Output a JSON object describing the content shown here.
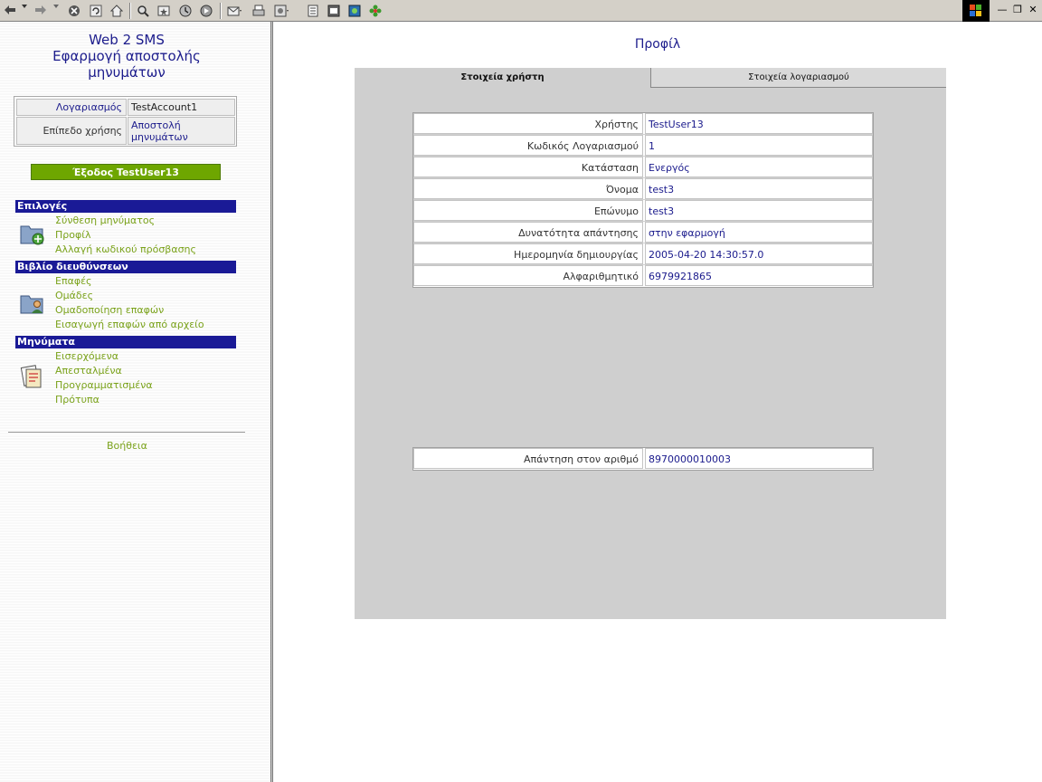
{
  "browser": {
    "toolbar_buttons": [
      "back-icon",
      "forward-icon",
      "stop-icon",
      "refresh-icon",
      "home-icon",
      "search-icon",
      "favorites-icon",
      "history-icon",
      "media-icon",
      "mail-icon",
      "print-icon",
      "edit-icon",
      "notes-icon",
      "sms-icon",
      "messenger-icon",
      "icq-icon"
    ]
  },
  "sidebar": {
    "app_title_line1": "Web 2 SMS",
    "app_title_line2": "Εφαρμογή αποστολής",
    "app_title_line3": "μηνυμάτων",
    "account_label": "Λογαριασμός",
    "account_value": "TestAccount1",
    "level_label": "Επίπεδο χρήσης",
    "level_value_line1": "Αποστολή",
    "level_value_line2": "μηνυμάτων",
    "logout_label": "Έξοδος TestUser13",
    "sections": [
      {
        "title": "Επιλογές",
        "items": [
          "Σύνθεση μηνύματος",
          "Προφίλ",
          "Αλλαγή κωδικού πρόσβασης"
        ]
      },
      {
        "title": "Βιβλίο διευθύνσεων",
        "items": [
          "Επαφές",
          "Ομάδες",
          "Ομαδοποίηση επαφών",
          "Εισαγωγή επαφών από αρχείο"
        ]
      },
      {
        "title": "Μηνύματα",
        "items": [
          "Εισερχόμενα",
          "Απεσταλμένα",
          "Προγραμματισμένα",
          "Πρότυπα"
        ]
      }
    ],
    "help_label": "Βοήθεια"
  },
  "main": {
    "page_title": "Προφίλ",
    "tabs": [
      {
        "label": "Στοιχεία χρήστη",
        "active": true
      },
      {
        "label": "Στοιχεία λογαριασμού",
        "active": false
      }
    ],
    "user_info": [
      {
        "label": "Χρήστης",
        "value": "TestUser13"
      },
      {
        "label": "Κωδικός Λογαριασμού",
        "value": "1"
      },
      {
        "label": "Κατάσταση",
        "value": "Ενεργός"
      },
      {
        "label": "Όνομα",
        "value": "test3"
      },
      {
        "label": "Επώνυμο",
        "value": "test3"
      },
      {
        "label": "Δυνατότητα απάντησης",
        "value": "στην εφαρμογή"
      },
      {
        "label": "Ημερομηνία δημιουργίας",
        "value": "2005-04-20 14:30:57.0"
      },
      {
        "label": "Αλφαριθμητικό",
        "value": "6979921865"
      }
    ],
    "reply_info": {
      "label": "Απάντηση στον αριθμό",
      "value": "8970000010003"
    }
  },
  "colors": {
    "nav_link": "#7aa21a",
    "section_header": "#1a1a96",
    "title_blue": "#1c1c8c",
    "logout_button": "#6ea600",
    "panel_gray": "#cfcfcf"
  }
}
